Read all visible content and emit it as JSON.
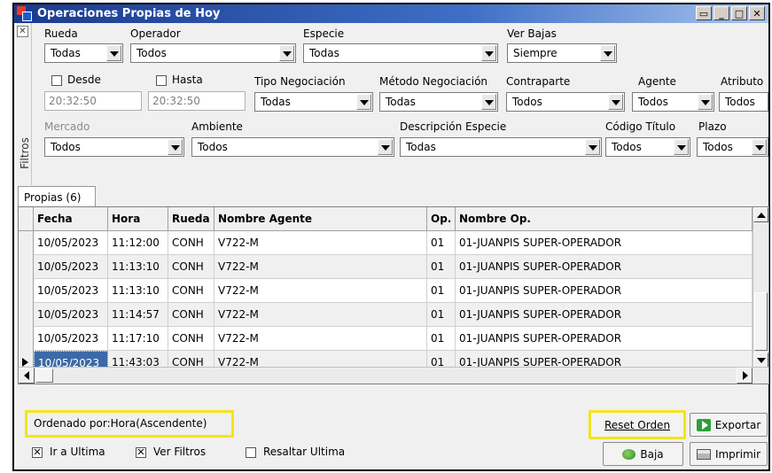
{
  "window": {
    "title": "Operaciones Propias de Hoy"
  },
  "filters": {
    "side_label": "Filtros",
    "rueda": {
      "label": "Rueda",
      "value": "Todas"
    },
    "operador": {
      "label": "Operador",
      "value": "Todos"
    },
    "especie": {
      "label": "Especie",
      "value": "Todas"
    },
    "ver_bajas": {
      "label": "Ver Bajas",
      "value": "Siempre"
    },
    "desde": {
      "label": "Desde",
      "value": "20:32:50"
    },
    "hasta": {
      "label": "Hasta",
      "value": "20:32:50"
    },
    "tipo_negociacion": {
      "label": "Tipo Negociación",
      "value": "Todas"
    },
    "metodo_negociacion": {
      "label": "Método Negociación",
      "value": "Todas"
    },
    "contraparte": {
      "label": "Contraparte",
      "value": "Todos"
    },
    "agente": {
      "label": "Agente",
      "value": "Todos"
    },
    "atributo": {
      "label": "Atributo",
      "value": "Todos"
    },
    "mercado": {
      "label": "Mercado",
      "value": "Todos"
    },
    "ambiente": {
      "label": "Ambiente",
      "value": "Todos"
    },
    "descripcion_especie": {
      "label": "Descripción Especie",
      "value": "Todas"
    },
    "codigo_titulo": {
      "label": "Código Título",
      "value": "Todos"
    },
    "plazo": {
      "label": "Plazo",
      "value": "Todos"
    }
  },
  "tab": {
    "label": "Propias (6)"
  },
  "grid": {
    "columns": [
      "Fecha",
      "Hora",
      "Rueda",
      "Nombre Agente",
      "Op.",
      "Nombre Op."
    ],
    "rows": [
      [
        "10/05/2023",
        "11:12:00",
        "CONH",
        "V722-M",
        "01",
        "01-JUANPIS SUPER-OPERADOR"
      ],
      [
        "10/05/2023",
        "11:13:10",
        "CONH",
        "V722-M",
        "01",
        "01-JUANPIS SUPER-OPERADOR"
      ],
      [
        "10/05/2023",
        "11:13:10",
        "CONH",
        "V722-M",
        "01",
        "01-JUANPIS SUPER-OPERADOR"
      ],
      [
        "10/05/2023",
        "11:14:57",
        "CONH",
        "V722-M",
        "01",
        "01-JUANPIS SUPER-OPERADOR"
      ],
      [
        "10/05/2023",
        "11:17:10",
        "CONH",
        "V722-M",
        "01",
        "01-JUANPIS SUPER-OPERADOR"
      ],
      [
        "10/05/2023",
        "11:43:03",
        "CONH",
        "V722-M",
        "01",
        "01-JUANPIS SUPER-OPERADOR"
      ]
    ]
  },
  "footer": {
    "sort_label": "Ordenado por:Hora(Ascendente)",
    "ir_a_ultima": "Ir a Ultima",
    "ver_filtros": "Ver Filtros",
    "resaltar_ultima": "Resaltar Ultima",
    "reset_orden": "Reset Orden",
    "exportar": "Exportar",
    "baja": "Baja",
    "imprimir": "Imprimir"
  },
  "colors": {
    "highlight": "#f2e51a",
    "title_bar": "#1a3a8f",
    "selection": "#3c6aa8"
  }
}
